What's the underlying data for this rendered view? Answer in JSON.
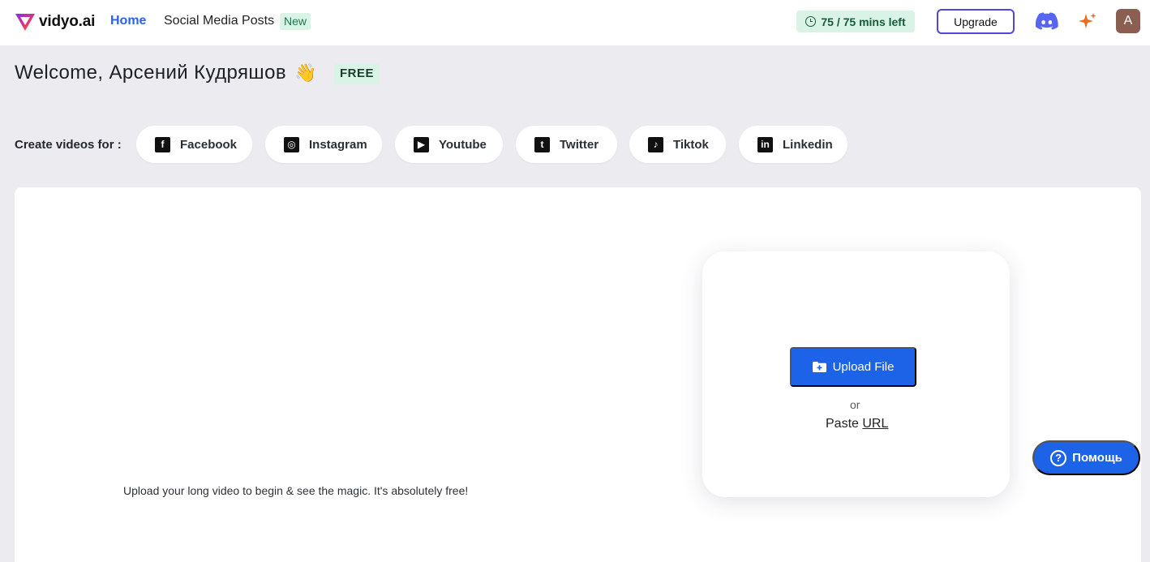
{
  "topbar": {
    "brand": "vidyo.ai",
    "nav_home": "Home",
    "nav_social": "Social Media Posts",
    "new_badge": "New",
    "mins_left": "75 / 75 mins left",
    "upgrade_label": "Upgrade",
    "avatar_initial": "A",
    "icons": [
      "clock-icon",
      "discord-icon",
      "sparkle-icon"
    ]
  },
  "welcome": {
    "greeting": "Welcome, Арсений Кудряшов",
    "emoji": "👋",
    "plan_badge": "FREE"
  },
  "platforms": {
    "label": "Create videos for :",
    "items": [
      {
        "label": "Facebook",
        "glyph": "f"
      },
      {
        "label": "Instagram",
        "glyph": "◎"
      },
      {
        "label": "Youtube",
        "glyph": "▶"
      },
      {
        "label": "Twitter",
        "glyph": "t"
      },
      {
        "label": "Tiktok",
        "glyph": "♪"
      },
      {
        "label": "Linkedin",
        "glyph": "in"
      }
    ]
  },
  "main": {
    "tagline": "Upload your long video to begin & see the magic. It's absolutely free!",
    "upload_label": "Upload File",
    "or_text": "or",
    "paste_text": "Paste",
    "url_text": "URL"
  },
  "help": {
    "label": "Помощь",
    "glyph": "?"
  },
  "colors": {
    "accent": "#1d63e8",
    "brand_nav": "#2b63e8",
    "upgrade_border": "#5146d8",
    "discord": "#5865f2",
    "sparkle": "#f26a1b",
    "badge_bg": "#d9f3e6",
    "page_bg": "#ebebf0"
  }
}
